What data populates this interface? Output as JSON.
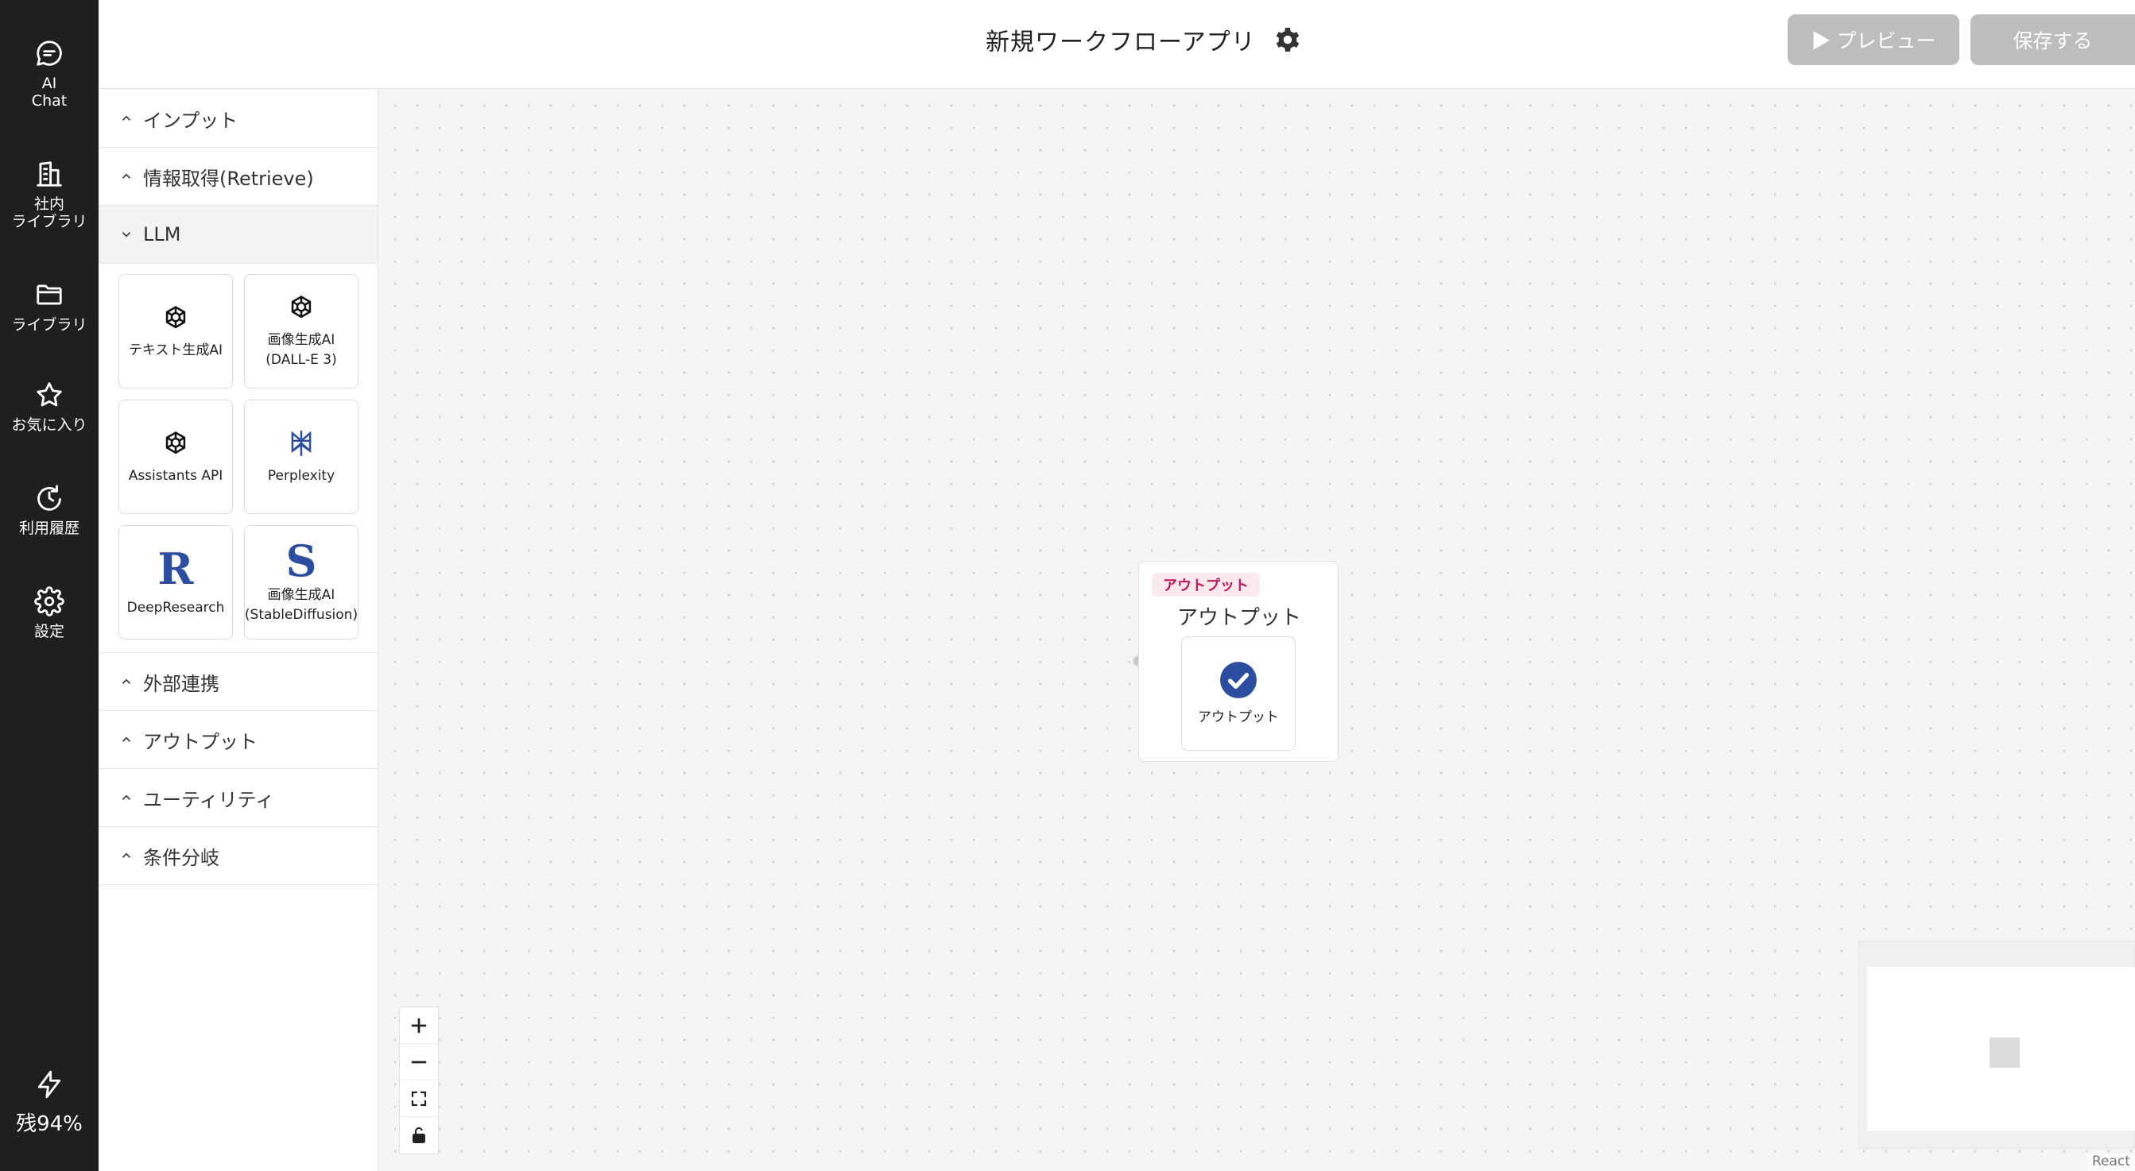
{
  "nav": {
    "items": [
      {
        "label": "AI\nChat",
        "icon": "chat-bubble-icon"
      },
      {
        "label": "社内\nライブラリ",
        "icon": "building-icon"
      },
      {
        "label": "ライブラリ",
        "icon": "folder-icon"
      },
      {
        "label": "お気に入り",
        "icon": "star-icon"
      },
      {
        "label": "利用履歴",
        "icon": "history-icon"
      },
      {
        "label": "設定",
        "icon": "gear-icon"
      }
    ],
    "remaining": "残94%"
  },
  "header": {
    "title": "新規ワークフローアプリ",
    "preview_label": "▶ プレビュー",
    "save_label": "保存する"
  },
  "palette": {
    "sections": {
      "input": "インプット",
      "retrieve": "情報取得(Retrieve)",
      "llm": "LLM",
      "external": "外部連携",
      "output": "アウトプット",
      "utility": "ユーティリティ",
      "branch": "条件分岐"
    },
    "llm_tiles": [
      {
        "label": "テキスト生成AI",
        "icon": "openai-icon"
      },
      {
        "label": "画像生成AI\n(DALL-E 3)",
        "icon": "openai-icon"
      },
      {
        "label": "Assistants API",
        "icon": "openai-icon"
      },
      {
        "label": "Perplexity",
        "icon": "perplexity-icon"
      },
      {
        "label": "DeepResearch",
        "icon": "letter-r-icon",
        "glyph": "R"
      },
      {
        "label": "画像生成AI\n(StableDiffusion)",
        "icon": "letter-s-icon",
        "glyph": "S"
      }
    ]
  },
  "canvas": {
    "node": {
      "tag": "アウトプット",
      "title": "アウトプット",
      "inner_label": "アウトプット"
    },
    "attribution": "React F"
  },
  "colors": {
    "nav_bg": "#1f1f1f",
    "button_disabled": "#bdbdbd",
    "tag_text": "#c2185b",
    "brand_blue": "#2b4ea1"
  }
}
